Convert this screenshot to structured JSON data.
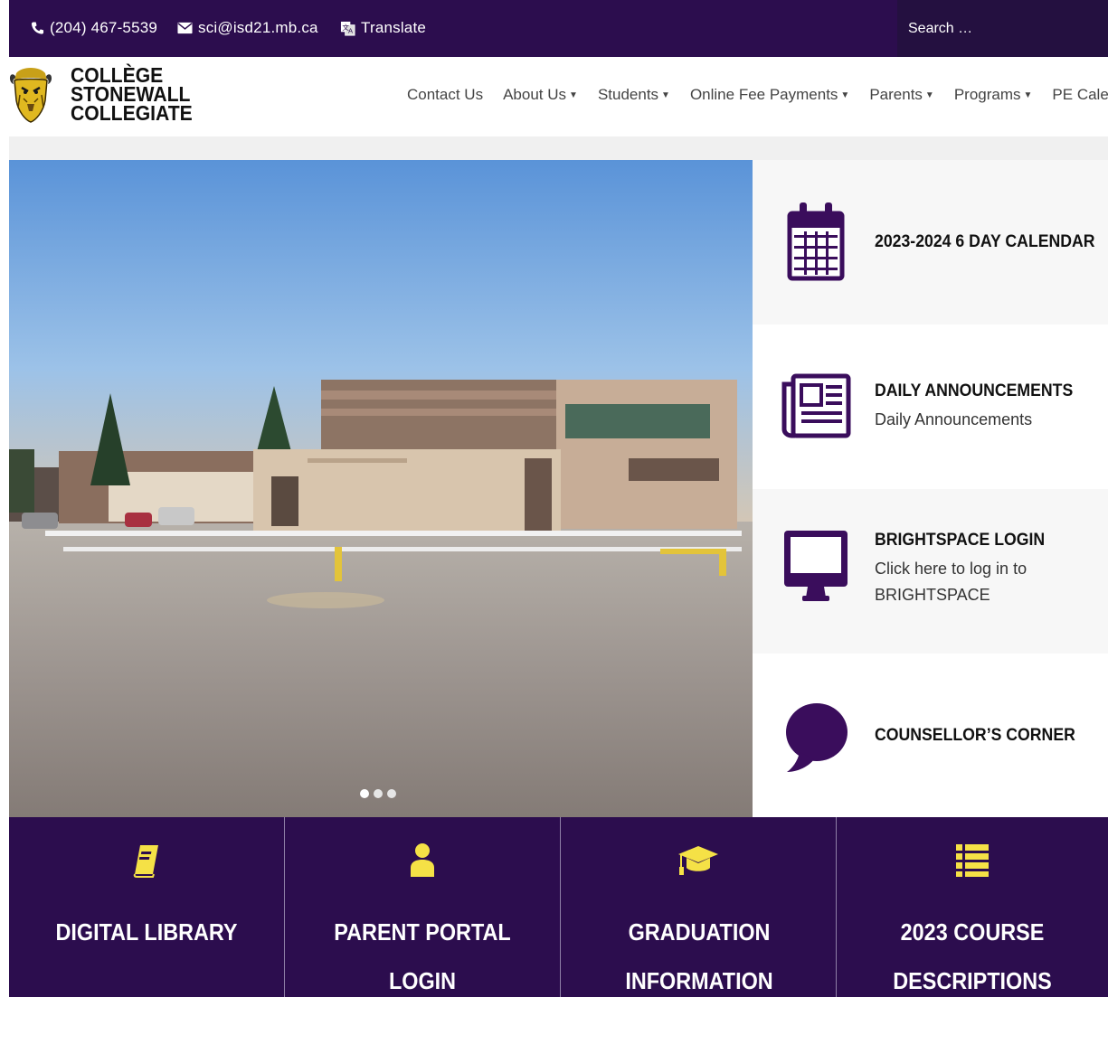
{
  "topbar": {
    "phone": "(204) 467-5539",
    "email": "sci@isd21.mb.ca",
    "translate": "Translate",
    "search_placeholder": "Search …"
  },
  "header": {
    "logo_line1": "COLLÈGE",
    "logo_line2": "STONEWALL",
    "logo_line3": "COLLEGIATE",
    "nav": [
      {
        "label": "Contact Us",
        "dropdown": false
      },
      {
        "label": "About Us",
        "dropdown": true
      },
      {
        "label": "Students",
        "dropdown": true
      },
      {
        "label": "Online Fee Payments",
        "dropdown": true
      },
      {
        "label": "Parents",
        "dropdown": true
      },
      {
        "label": "Programs",
        "dropdown": true
      },
      {
        "label": "PE Calendar",
        "dropdown": false
      }
    ]
  },
  "tiles": [
    {
      "title": "2023-2024 6 DAY CALENDAR",
      "subtitle": "",
      "icon": "calendar-icon"
    },
    {
      "title": "DAILY ANNOUNCEMENTS",
      "subtitle": "Daily Announcements",
      "icon": "newspaper-icon"
    },
    {
      "title": "BRIGHTSPACE LOGIN",
      "subtitle": "Click here to log in to BRIGHTSPACE",
      "icon": "monitor-icon"
    },
    {
      "title": "COUNSELLOR’S CORNER",
      "subtitle": "",
      "icon": "speech-bubble-icon"
    }
  ],
  "bottom_links": [
    {
      "label": "DIGITAL LIBRARY",
      "icon": "book-icon"
    },
    {
      "label": "PARENT PORTAL LOGIN",
      "icon": "user-icon"
    },
    {
      "label": "GRADUATION INFORMATION (UPDATED)",
      "icon": "graduation-cap-icon"
    },
    {
      "label": "2023 COURSE DESCRIPTIONS",
      "icon": "list-icon"
    }
  ],
  "colors": {
    "brand_purple": "#2c0d4e",
    "accent_yellow": "#f5e146",
    "tile_gray": "#f7f7f7"
  },
  "carousel": {
    "slides": 3,
    "active": 1
  }
}
